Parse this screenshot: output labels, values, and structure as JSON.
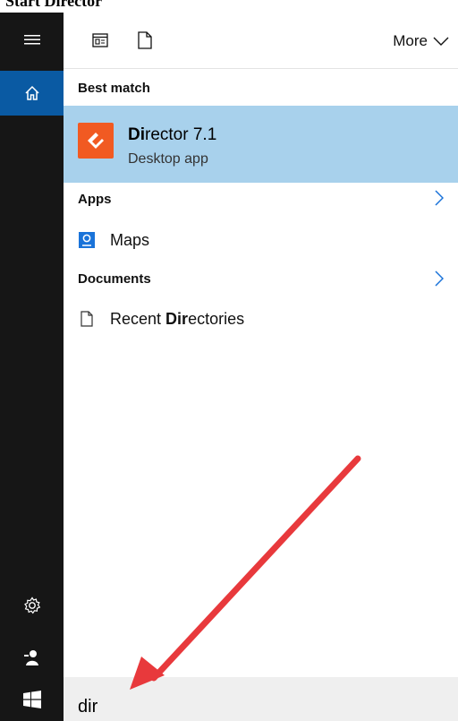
{
  "caption": "Start Director",
  "toolbar": {
    "more_label": "More"
  },
  "best_match": {
    "header": "Best match",
    "app_name_bold": "Di",
    "app_name_rest": "rector 7.1",
    "app_type": "Desktop app"
  },
  "apps": {
    "header": "Apps",
    "items": [
      {
        "label": "Maps"
      }
    ]
  },
  "documents": {
    "header": "Documents",
    "items": [
      {
        "label_pre": "Recent ",
        "label_bold": "Dir",
        "label_post": "ectories"
      }
    ]
  },
  "search": {
    "value": "dir"
  },
  "colors": {
    "rail": "#161616",
    "home_active": "#0a5aa3",
    "best_match_bg": "#a8d1ec",
    "app_icon": "#f15a22",
    "arrow": "#e8393c",
    "search_bg": "#efefef"
  }
}
